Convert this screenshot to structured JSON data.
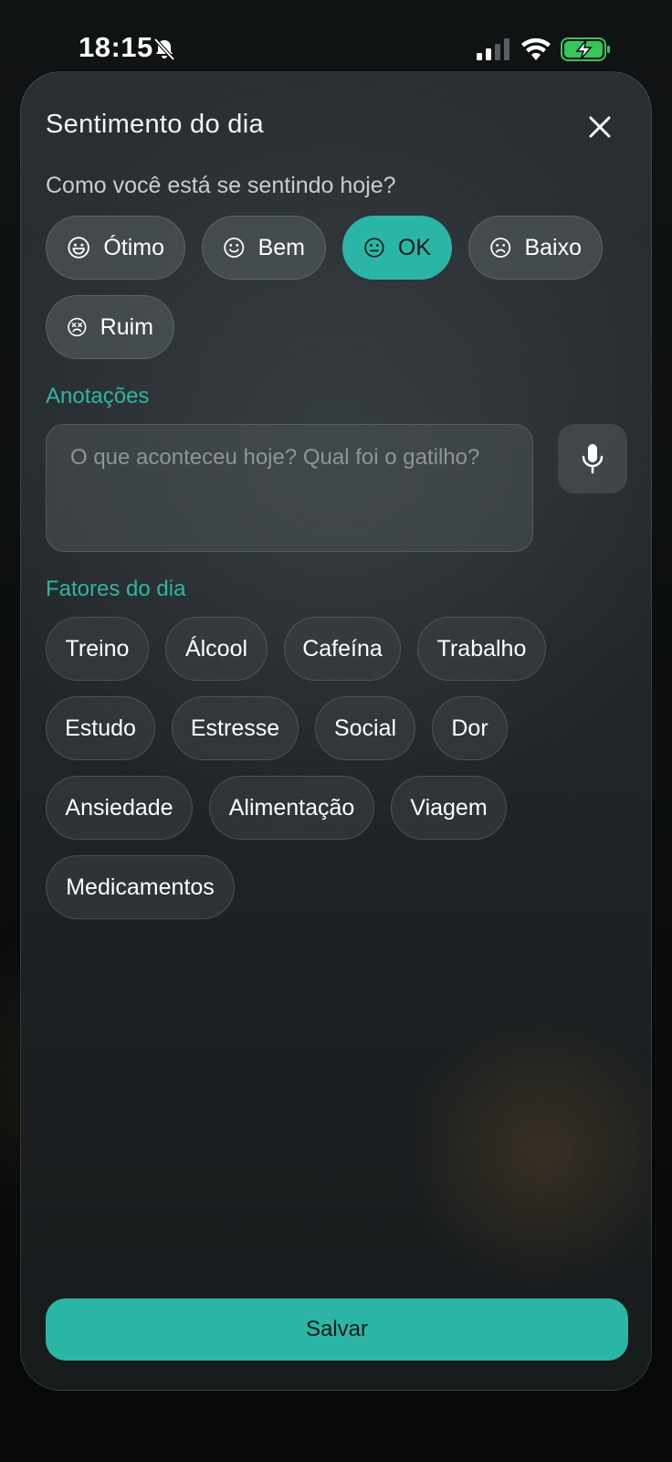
{
  "status_bar": {
    "time": "18:15",
    "icons": [
      "bell-slash-icon",
      "cellular-signal-icon",
      "wifi-icon",
      "battery-charging-icon"
    ],
    "battery_color": "#34c759"
  },
  "sheet": {
    "title": "Sentimento do dia",
    "close_icon": "close-icon",
    "prompt": "Como você está se sentindo hoje?",
    "moods": [
      {
        "label": "Ótimo",
        "icon": "grin-face-icon",
        "selected": false
      },
      {
        "label": "Bem",
        "icon": "smile-face-icon",
        "selected": false
      },
      {
        "label": "OK",
        "icon": "neutral-face-icon",
        "selected": true
      },
      {
        "label": "Baixo",
        "icon": "sad-face-icon",
        "selected": false
      },
      {
        "label": "Ruim",
        "icon": "dizzy-face-icon",
        "selected": false
      }
    ],
    "notes": {
      "label": "Anotações",
      "placeholder": "O que aconteceu hoje? Qual foi o gatilho?",
      "value": "",
      "mic_icon": "microphone-icon"
    },
    "factors": {
      "label": "Fatores do dia",
      "items": [
        "Treino",
        "Álcool",
        "Cafeína",
        "Trabalho",
        "Estudo",
        "Estresse",
        "Social",
        "Dor",
        "Ansiedade",
        "Alimentação",
        "Viagem",
        "Medicamentos"
      ]
    },
    "save_label": "Salvar"
  },
  "colors": {
    "accent": "#2bb5a6",
    "section_label": "#2fb5a5"
  }
}
